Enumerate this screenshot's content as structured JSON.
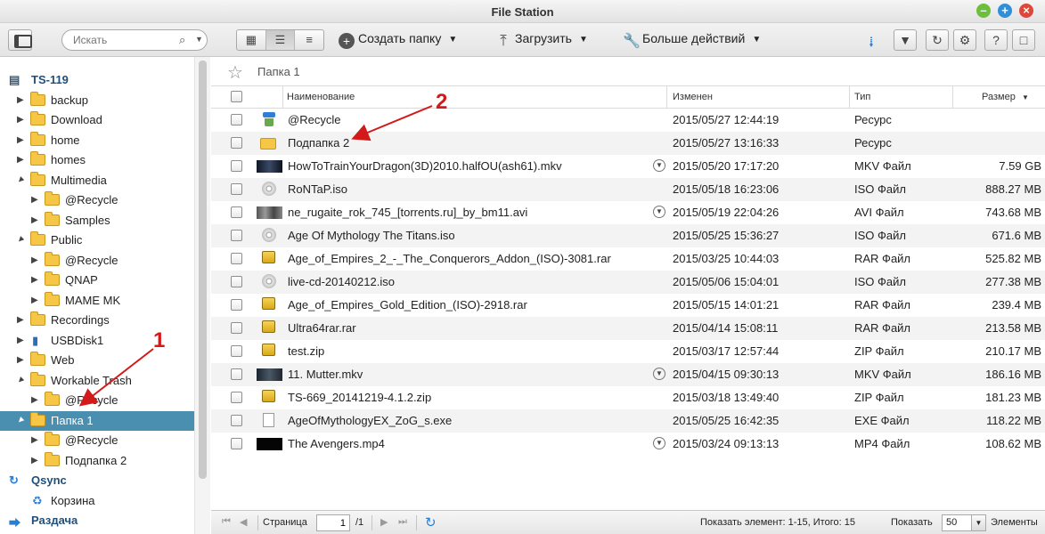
{
  "window": {
    "title": "File Station"
  },
  "toolbar": {
    "search_placeholder": "Искать",
    "create_folder": "Создать папку",
    "upload": "Загрузить",
    "more_actions": "Больше действий"
  },
  "sidebar": {
    "items": [
      {
        "label": "TS-119",
        "icon": "nas-icon",
        "root": true
      },
      {
        "label": "backup",
        "icon": "folder-icon"
      },
      {
        "label": "Download",
        "icon": "folder-icon"
      },
      {
        "label": "home",
        "icon": "folder-icon"
      },
      {
        "label": "homes",
        "icon": "folder-icon"
      },
      {
        "label": "Multimedia",
        "icon": "folder-icon"
      },
      {
        "label": "@Recycle",
        "icon": "folder-icon"
      },
      {
        "label": "Samples",
        "icon": "folder-icon"
      },
      {
        "label": "Public",
        "icon": "folder-icon"
      },
      {
        "label": "@Recycle",
        "icon": "folder-icon"
      },
      {
        "label": "QNAP",
        "icon": "folder-icon"
      },
      {
        "label": "MAME MK",
        "icon": "folder-icon"
      },
      {
        "label": "Recordings",
        "icon": "folder-icon"
      },
      {
        "label": "USBDisk1",
        "icon": "usb-icon"
      },
      {
        "label": "Web",
        "icon": "folder-icon"
      },
      {
        "label": "Workable Trash",
        "icon": "folder-icon"
      },
      {
        "label": "@Recycle",
        "icon": "folder-icon"
      },
      {
        "label": "Папка 1",
        "icon": "folder-icon",
        "selected": true
      },
      {
        "label": "@Recycle",
        "icon": "folder-icon"
      },
      {
        "label": "Подпапка 2",
        "icon": "folder-icon"
      },
      {
        "label": "Qsync",
        "icon": "qsync-icon",
        "root": true
      },
      {
        "label": "Корзина",
        "icon": "recycle-bin-icon"
      },
      {
        "label": "Раздача",
        "icon": "share-icon",
        "root": true
      }
    ]
  },
  "path": {
    "current": "Папка 1"
  },
  "table": {
    "headers": {
      "name": "Наименование",
      "modified": "Изменен",
      "type": "Тип",
      "size": "Размер"
    },
    "rows": [
      {
        "name": "@Recycle",
        "modified": "2015/05/27 12:44:19",
        "type": "Ресурс",
        "size": "",
        "icon": "recycle-icon"
      },
      {
        "name": "Подпапка 2",
        "modified": "2015/05/27 13:16:33",
        "type": "Ресурс",
        "size": "",
        "icon": "folder-icon"
      },
      {
        "name": "HowToTrainYourDragon(3D)2010.halfOU(ash61).mkv",
        "modified": "2015/05/20 17:17:20",
        "type": "MKV Файл",
        "size": "7.59 GB",
        "icon": "video-thumbnail-icon"
      },
      {
        "name": "RoNTaP.iso",
        "modified": "2015/05/18 16:23:06",
        "type": "ISO Файл",
        "size": "888.27 MB",
        "icon": "disc-icon"
      },
      {
        "name": "ne_rugaite_rok_745_[torrents.ru]_by_bm11.avi",
        "modified": "2015/05/19 22:04:26",
        "type": "AVI Файл",
        "size": "743.68 MB",
        "icon": "video-thumbnail-icon"
      },
      {
        "name": "Age Of Mythology The Titans.iso",
        "modified": "2015/05/25 15:36:27",
        "type": "ISO Файл",
        "size": "671.6 MB",
        "icon": "disc-icon"
      },
      {
        "name": "Age_of_Empires_2_-_The_Conquerors_Addon_(ISO)-3081.rar",
        "modified": "2015/03/25 10:44:03",
        "type": "RAR Файл",
        "size": "525.82 MB",
        "icon": "archive-icon"
      },
      {
        "name": "live-cd-20140212.iso",
        "modified": "2015/05/06 15:04:01",
        "type": "ISO Файл",
        "size": "277.38 MB",
        "icon": "disc-icon"
      },
      {
        "name": "Age_of_Empires_Gold_Edition_(ISO)-2918.rar",
        "modified": "2015/05/15 14:01:21",
        "type": "RAR Файл",
        "size": "239.4 MB",
        "icon": "archive-icon"
      },
      {
        "name": "Ultra64rar.rar",
        "modified": "2015/04/14 15:08:11",
        "type": "RAR Файл",
        "size": "213.58 MB",
        "icon": "archive-icon"
      },
      {
        "name": "test.zip",
        "modified": "2015/03/17 12:57:44",
        "type": "ZIP Файл",
        "size": "210.17 MB",
        "icon": "archive-icon"
      },
      {
        "name": "11. Mutter.mkv",
        "modified": "2015/04/15 09:30:13",
        "type": "MKV Файл",
        "size": "186.16 MB",
        "icon": "video-thumbnail-icon"
      },
      {
        "name": "TS-669_20141219-4.1.2.zip",
        "modified": "2015/03/18 13:49:40",
        "type": "ZIP Файл",
        "size": "181.23 MB",
        "icon": "archive-icon"
      },
      {
        "name": "AgeOfMythologyEX_ZoG_s.exe",
        "modified": "2015/05/25 16:42:35",
        "type": "EXE Файл",
        "size": "118.22 MB",
        "icon": "file-icon"
      },
      {
        "name": "The Avengers.mp4",
        "modified": "2015/03/24 09:13:13",
        "type": "MP4 Файл",
        "size": "108.62 MB",
        "icon": "video-thumbnail-icon"
      }
    ]
  },
  "footer": {
    "page_label": "Страница",
    "page_value": "1",
    "page_total": "/1",
    "show_items": "Показать элемент: 1-15, Итого: 15",
    "show_label": "Показать",
    "per_page": "50",
    "items_label": "Элементы"
  },
  "annotations": {
    "label_1": "1",
    "label_2": "2",
    "color": "#d21a1a"
  }
}
